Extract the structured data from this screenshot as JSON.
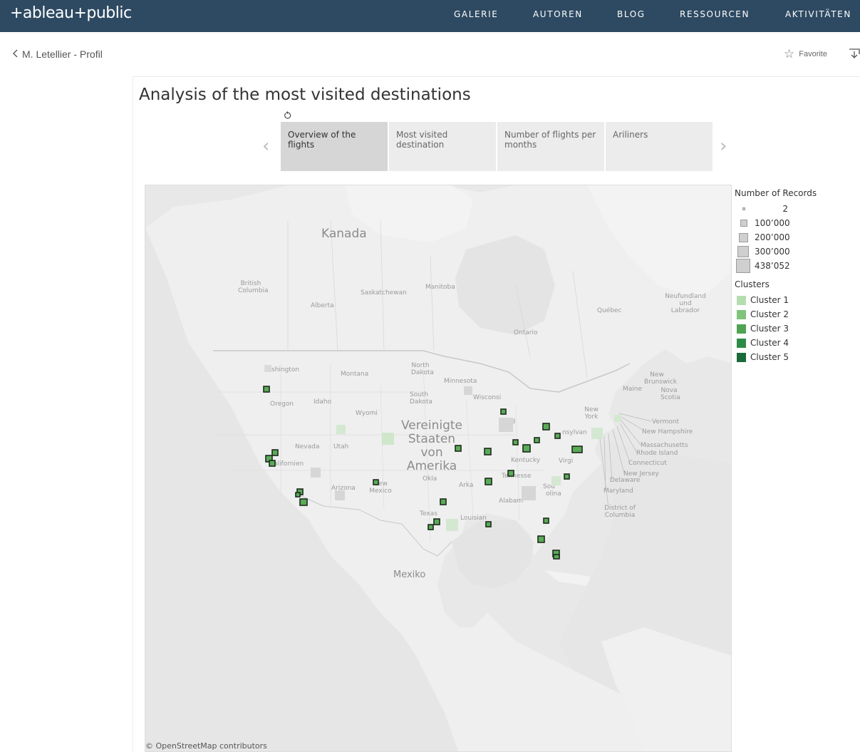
{
  "header": {
    "logo_text": "+ableau+public",
    "nav": [
      "GALERIE",
      "AUTOREN",
      "BLOG",
      "RESSOURCEN",
      "AKTIVITÄTEN"
    ]
  },
  "subbar": {
    "back_label": "M. Letellier - Profil",
    "favorite_label": "Favorite"
  },
  "story": {
    "title": "Analysis of the most visited destinations",
    "tabs": [
      {
        "label": "Overview of the flights",
        "active": true
      },
      {
        "label": "Most visited destination",
        "active": false
      },
      {
        "label": "Number of flights per months",
        "active": false
      },
      {
        "label": "Ariliners",
        "active": false
      }
    ]
  },
  "map": {
    "labels": {
      "kanada": "Kanada",
      "usa": "Vereinigte Staaten von Amerika",
      "mexiko": "Mexiko",
      "british_columbia": "British Columbia",
      "alberta": "Alberta",
      "saskatchewan": "Saskatchewan",
      "manitoba": "Manitoba",
      "ontario": "Ontario",
      "quebec": "Québec",
      "neufundland": "Neufundland und Labrador",
      "new_brunswick": "New Brunswick",
      "nova_scotia": "Nova Scotia",
      "maine": "Maine",
      "washington": "shington",
      "montana": "Montana",
      "north_dakota": "North Dakota",
      "minnesota": "Minnesota",
      "south_dakota": "South Dakota",
      "wisconsin": "Wisconsi",
      "oregon": "Oregon",
      "idaho": "Idaho",
      "wyoming": "Wyomi",
      "nevada": "Nevada",
      "utah": "Utah",
      "california": "alifornien",
      "arizona": "Arizona",
      "new_mexico": "New Mexico",
      "oklahoma": "Okla",
      "texas": "Texas",
      "louisiana": "Louisian",
      "alabama": "Alabam",
      "kentucky": "Kentucky",
      "tennessee": "Tennesse",
      "carolina": "olina",
      "virginia": "Virgi",
      "pennsylvania": "nsylvan",
      "new_york": "New York",
      "vermont": "Vermont",
      "new_hampshire": "New Hampshire",
      "massachusetts": "Massachusetts",
      "rhode_island": "Rhode Island",
      "connecticut": "Connecticut",
      "new_jersey": "New Jersey",
      "delaware": "Delaware",
      "maryland": "Maryland",
      "dc": "District of Columbia",
      "arkansas": "Arka",
      "indiana": "Ind",
      "south_carolina": "Sou"
    },
    "attribution": "© OpenStreetMap contributors"
  },
  "legend": {
    "size_title": "Number of Records",
    "sizes": [
      "2",
      "100’000",
      "200’000",
      "300’000",
      "438’052"
    ],
    "clusters_title": "Clusters",
    "clusters": [
      {
        "label": "Cluster 1",
        "color": "#b5ddb0"
      },
      {
        "label": "Cluster 2",
        "color": "#7fc47a"
      },
      {
        "label": "Cluster 3",
        "color": "#4fa352"
      },
      {
        "label": "Cluster 4",
        "color": "#2e8b47"
      },
      {
        "label": "Cluster 5",
        "color": "#1a6a3a"
      }
    ]
  },
  "colors": {
    "header_bg": "#2e4a62",
    "map_bg": "#e8e8e8",
    "highlight_green": "#5aab57"
  }
}
